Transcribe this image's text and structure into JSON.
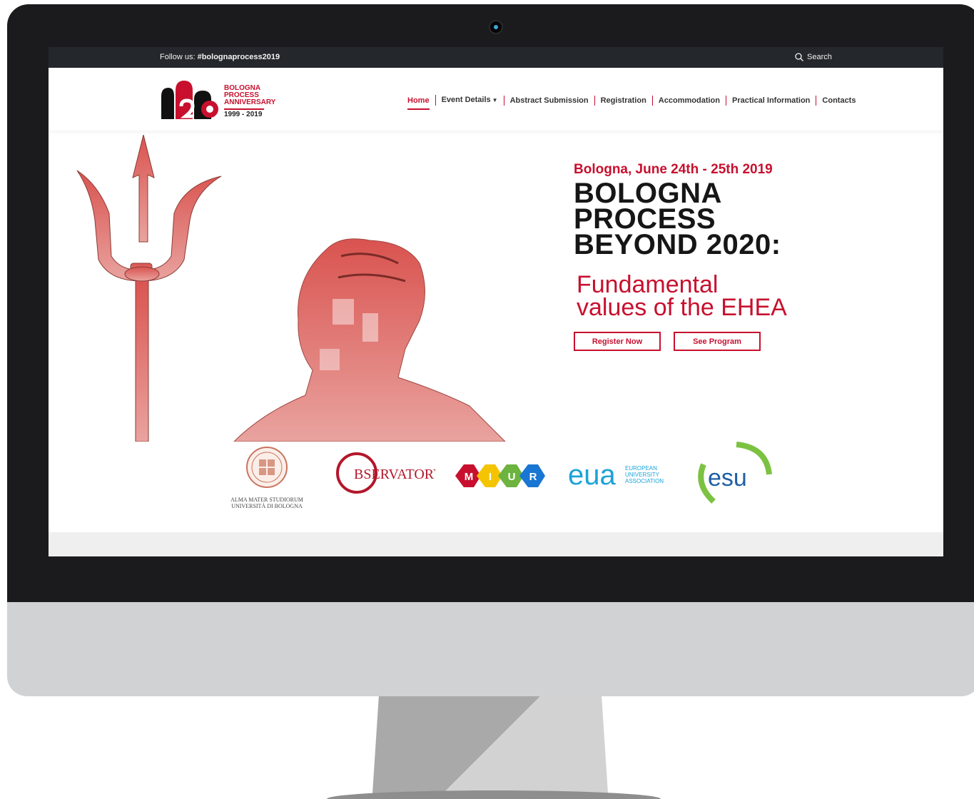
{
  "topbar": {
    "follow_prefix": "Follow us: ",
    "follow_tag": "#bolognaprocess2019",
    "search_label": "Search"
  },
  "logo": {
    "line1": "BOLOGNA",
    "line2": "PROCESS",
    "line3": "ANNIVERSARY",
    "years": "1999 - 2019"
  },
  "nav": {
    "items": [
      {
        "label": "Home",
        "active": true
      },
      {
        "label": "Event Details",
        "has_dropdown": true
      },
      {
        "label": "Abstract Submission"
      },
      {
        "label": "Registration"
      },
      {
        "label": "Accommodation"
      },
      {
        "label": "Practical Information"
      },
      {
        "label": "Contacts"
      }
    ]
  },
  "hero": {
    "date": "Bologna, June 24th - 25th 2019",
    "title_lines": [
      "BOLOGNA",
      "PROCESS",
      "BEYOND 2020:"
    ],
    "subtitle_lines": [
      "Fundamental",
      "values of the EHEA"
    ],
    "register_button": "Register Now",
    "program_button": "See Program"
  },
  "partners": {
    "alma_caption_1": "ALMA MATER STUDIORUM",
    "alma_caption_2": "UNIVERSITÀ DI BOLOGNA",
    "observatory": "BSERVATORY",
    "miur_letters": [
      "M",
      "I",
      "U",
      "R"
    ],
    "eua_mark": "eua",
    "eua_text_lines": [
      "EUROPEAN",
      "UNIVERSITY",
      "ASSOCIATION"
    ],
    "esu_mark": "esu"
  },
  "colors": {
    "brand_red": "#c8102e",
    "topbar_bg": "#24272b",
    "bezel": "#1b1b1d",
    "chin": "#d1d2d4"
  }
}
